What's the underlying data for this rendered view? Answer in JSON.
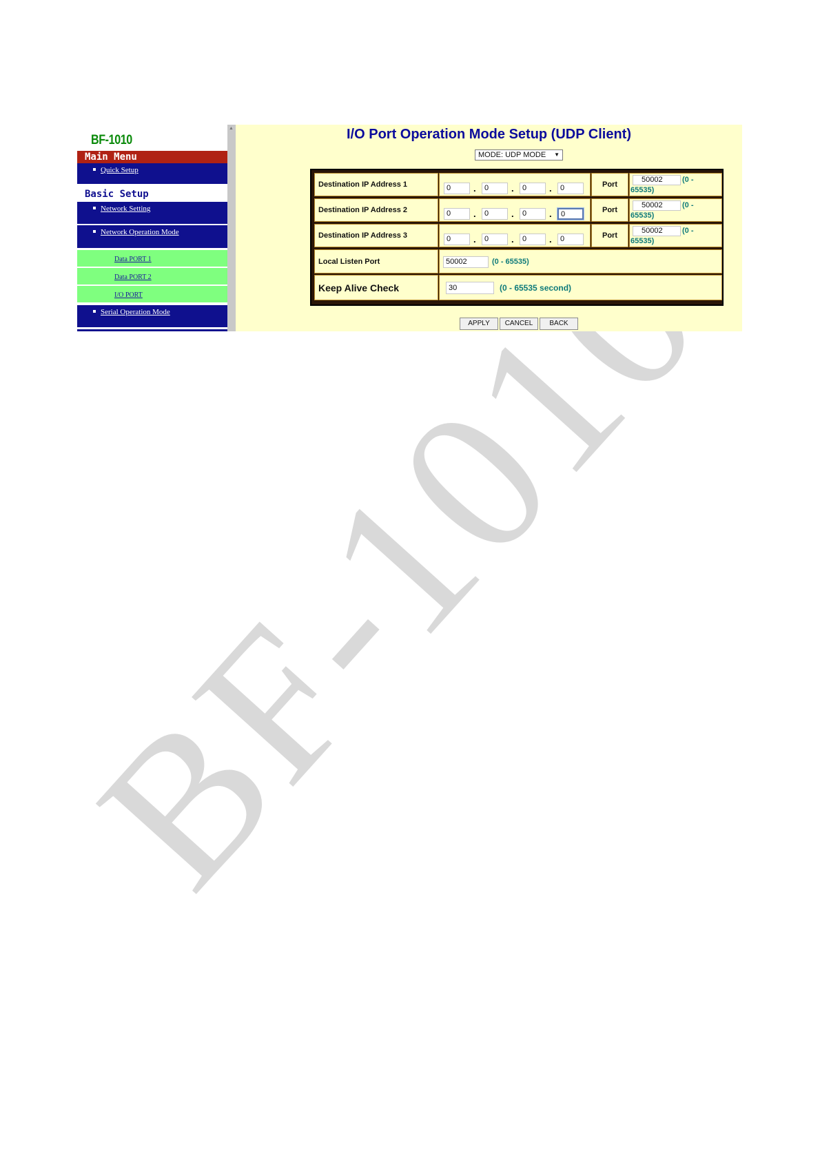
{
  "sidebar": {
    "logo": "BF-1010",
    "main_menu": "Main Menu",
    "quick_setup": "Quick Setup",
    "basic_setup": "Basic Setup",
    "network_setting": "Network Setting",
    "network_operation_mode": "Network Operation Mode",
    "data_port_1": "Data PORT 1",
    "data_port_2": "Data PORT 2",
    "io_port": "I/O PORT",
    "serial_operation_mode": "Serial Operation Mode"
  },
  "main": {
    "title": "I/O Port Operation Mode Setup (UDP Client)",
    "mode_select": "MODE: UDP MODE",
    "mode_arrow": "▼",
    "rows": [
      {
        "label": "Destination IP Address 1",
        "ip": [
          "0",
          "0",
          "0",
          "0"
        ],
        "port_label": "Port",
        "port": "50002",
        "range_a": "(0 -",
        "range_b": "65535)"
      },
      {
        "label": "Destination IP Address 2",
        "ip": [
          "0",
          "0",
          "0",
          "0"
        ],
        "port_label": "Port",
        "port": "50002",
        "range_a": "(0 -",
        "range_b": "65535)"
      },
      {
        "label": "Destination IP Address 3",
        "ip": [
          "0",
          "0",
          "0",
          "0"
        ],
        "port_label": "Port",
        "port": "50002",
        "range_a": "(0 -",
        "range_b": "65535)"
      }
    ],
    "dot": ".",
    "local_listen": {
      "label": "Local Listen Port",
      "value": "50002",
      "range": "(0 - 65535)"
    },
    "keep_alive": {
      "label": "Keep Alive Check",
      "value": "30",
      "range": "(0 - 65535 second)"
    },
    "buttons": {
      "apply": "APPLY",
      "cancel": "CANCEL",
      "back": "BACK"
    }
  },
  "watermark": "BF-1010",
  "colors": {
    "sidebar_blue": "#0f108e",
    "main_menu_red": "#b02214",
    "submenu_green": "#7fff7f",
    "content_bg": "#ffffcc",
    "title_blue": "#0b0b9c",
    "range_teal": "#0e7a7a"
  }
}
